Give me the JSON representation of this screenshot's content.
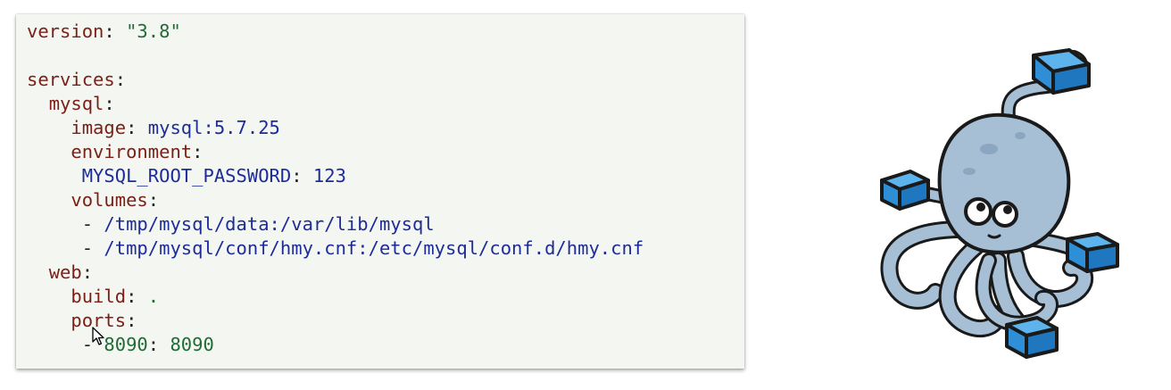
{
  "code": {
    "version_key": "version",
    "version_value": "\"3.8\"",
    "services_key": "services",
    "mysql_key": "mysql",
    "image_key": "image",
    "image_value": "mysql:5.7.25",
    "environment_key": "environment",
    "env_var_key": "MYSQL_ROOT_PASSWORD",
    "env_var_value": "123",
    "volumes_key": "volumes",
    "volume_1": "/tmp/mysql/data:/var/lib/mysql",
    "volume_2": "/tmp/mysql/conf/hmy.cnf:/etc/mysql/conf.d/hmy.cnf",
    "web_key": "web",
    "build_key": "build",
    "build_value": ".",
    "ports_key": "ports",
    "port_host": "8090",
    "port_container": "8090",
    "colon": ":",
    "dash": "-"
  },
  "colors": {
    "panel_bg": "#f3f6f1",
    "key": "#7a1f17",
    "string": "#216b37",
    "value": "#1d2c99",
    "mascot_body": "#a7bfd5",
    "container_blue": "#2f8fd6"
  },
  "icons": {
    "cursor": "mouse-pointer-icon",
    "mascot": "docker-compose-octopus-icon"
  }
}
